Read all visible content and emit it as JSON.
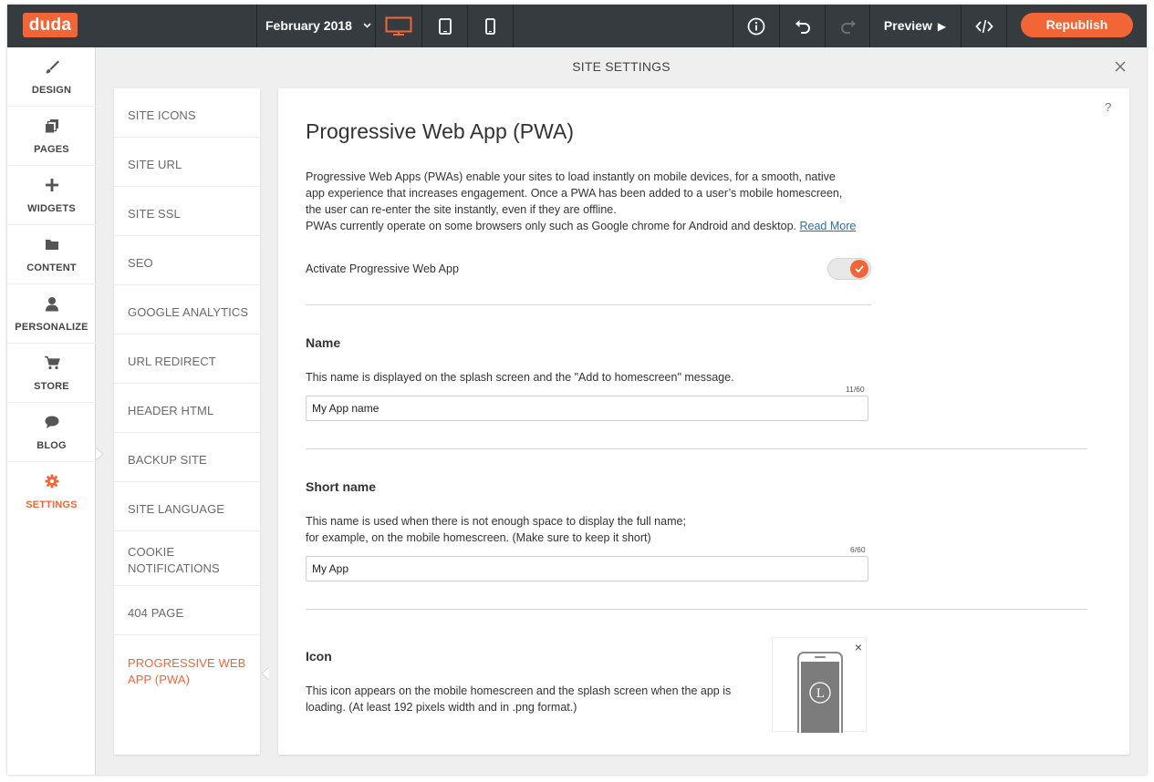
{
  "topbar": {
    "logo": "duda",
    "date_selector": "February 2018",
    "preview_label": "Preview",
    "republish_label": "Republish",
    "icons": [
      "desktop-icon",
      "tablet-icon",
      "mobile-icon",
      "info-icon",
      "undo-icon",
      "redo-icon",
      "play-icon",
      "code-icon"
    ],
    "active_device": "desktop"
  },
  "sidebar": {
    "items": [
      {
        "label": "DESIGN",
        "icon": "brush-icon"
      },
      {
        "label": "PAGES",
        "icon": "pages-icon"
      },
      {
        "label": "WIDGETS",
        "icon": "plus-icon"
      },
      {
        "label": "CONTENT",
        "icon": "folder-icon"
      },
      {
        "label": "PERSONALIZE",
        "icon": "person-icon"
      },
      {
        "label": "STORE",
        "icon": "cart-icon"
      },
      {
        "label": "BLOG",
        "icon": "chat-icon"
      },
      {
        "label": "SETTINGS",
        "icon": "gear-icon"
      }
    ],
    "active": "SETTINGS"
  },
  "settings": {
    "title": "SITE SETTINGS",
    "nav": [
      "SITE ICONS",
      "SITE URL",
      "SITE SSL",
      "SEO",
      "GOOGLE ANALYTICS",
      "URL REDIRECT",
      "HEADER HTML",
      "BACKUP SITE",
      "SITE LANGUAGE",
      "COOKIE",
      "NOTIFICATIONS",
      "404 PAGE",
      "PROGRESSIVE WEB",
      "APP (PWA)"
    ],
    "active_nav": "PROGRESSIVE WEB APP (PWA)"
  },
  "main": {
    "help": "?",
    "title": "Progressive Web App (PWA)",
    "desc_lines": [
      "Progressive Web Apps (PWAs) enable your sites to load instantly on mobile devices, for a smooth, native",
      "app experience that increases engagement. Once a PWA has been added to a user’s mobile homescreen,",
      "the user can re-enter the site instantly, even if they are offline.",
      "PWAs currently operate on some browsers only such as Google chrome for Android and desktop."
    ],
    "read_more": "Read More",
    "activate_label": "Activate Progressive Web App",
    "activate_enabled": true,
    "name": {
      "title": "Name",
      "desc": "This name is displayed on the splash screen and the \"Add to homescreen\" message.",
      "counter": "11/60",
      "value": "My App name"
    },
    "short_name": {
      "title": "Short name",
      "desc_1": "This name is used when there is not enough space to display the full name;",
      "desc_2": "for example, on the mobile homescreen. (Make sure to keep it short)",
      "counter": "6/60",
      "value": "My App"
    },
    "icon": {
      "title": "Icon",
      "desc_1": "This icon appears on the mobile homescreen and the splash screen when the app is",
      "desc_2": "loading. (At least 192 pixels width and in .png format.)",
      "remove": "×",
      "preview_letter": "L"
    }
  },
  "colors": {
    "accent": "#f26537",
    "topbar": "#363b40",
    "link": "#2a6fb0"
  }
}
